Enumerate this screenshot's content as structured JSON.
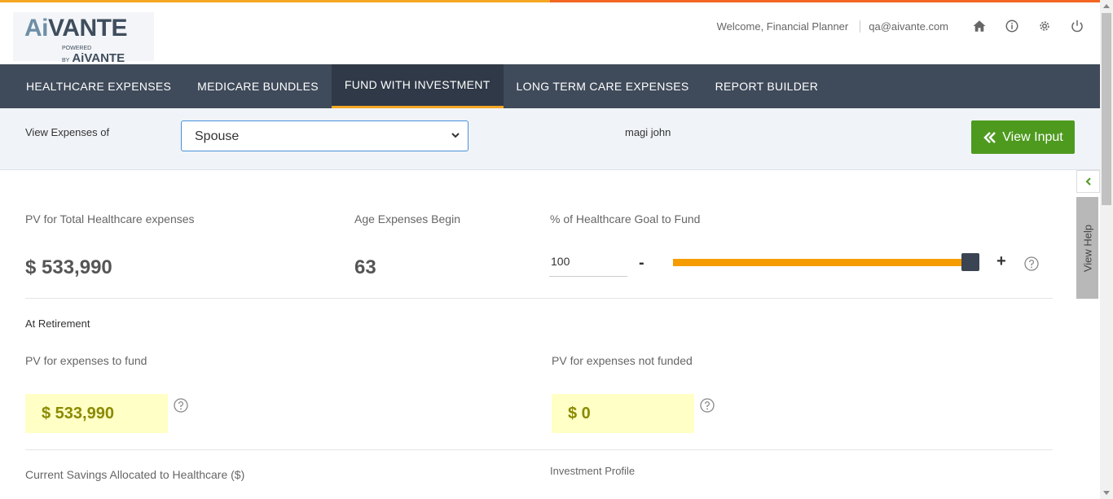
{
  "header": {
    "logo_text_ai": "Ai",
    "logo_text_main": "VANTE",
    "logo_powered": "POWERED BY",
    "logo_powered_brand": "AiVANTE",
    "welcome": "Welcome, Financial Planner",
    "email": "qa@aivante.com",
    "icons": [
      "home-icon",
      "info-icon",
      "gear-icon",
      "power-icon"
    ]
  },
  "nav": {
    "tabs": [
      {
        "label": "HEALTHCARE EXPENSES"
      },
      {
        "label": "MEDICARE BUNDLES"
      },
      {
        "label": "FUND WITH INVESTMENT"
      },
      {
        "label": "LONG TERM CARE EXPENSES"
      },
      {
        "label": "REPORT BUILDER"
      }
    ],
    "active_index": 2
  },
  "filter": {
    "label": "View Expenses of",
    "selected": "Spouse",
    "client_name": "magi john",
    "view_input_label": "View Input"
  },
  "summary": {
    "pv_total_label": "PV for Total Healthcare expenses",
    "pv_total_value": "$ 533,990",
    "age_label": "Age Expenses Begin",
    "age_value": "63",
    "goal_label": "% of Healthcare Goal to Fund",
    "goal_value": "100",
    "goal_fraction": 1.0,
    "minus": "-",
    "plus": "+"
  },
  "retirement": {
    "heading": "At Retirement",
    "fund_label": "PV for expenses to fund",
    "fund_value": "$ 533,990",
    "not_funded_label": "PV for expenses not funded",
    "not_funded_value": "$ 0"
  },
  "bottom": {
    "savings_label": "Current Savings Allocated to Healthcare ($)",
    "investment_label": "Investment Profile"
  },
  "side_help": {
    "label": "View Help"
  },
  "colors": {
    "accent_orange": "#f5a623",
    "nav_bg": "#3f4a5a",
    "button_green": "#4e9a1f",
    "slider": "#f59c00",
    "highlight": "#ffffc6"
  }
}
